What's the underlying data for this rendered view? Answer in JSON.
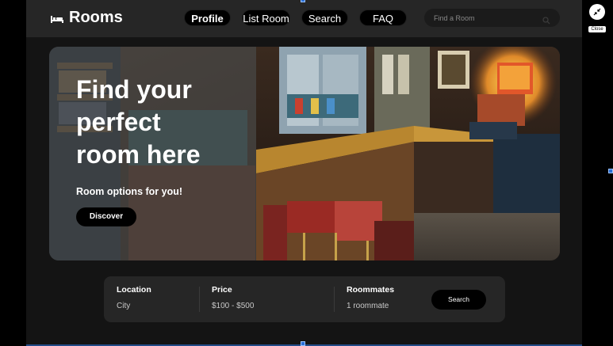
{
  "brand": {
    "name": "Rooms",
    "icon": "bed-icon"
  },
  "nav": {
    "links": [
      {
        "label": "Profile",
        "active": true
      },
      {
        "label": "List Room",
        "active": false
      },
      {
        "label": "Search",
        "active": false
      },
      {
        "label": "FAQ",
        "active": false
      }
    ],
    "search_placeholder": "Find a Room"
  },
  "hero": {
    "title": "Find your\nperfect\nroom here",
    "subtitle": "Room options for you!",
    "cta_label": "Discover"
  },
  "filters": {
    "location": {
      "label": "Location",
      "value": "City"
    },
    "price": {
      "label": "Price",
      "value": "$100 - $500"
    },
    "roommates": {
      "label": "Roommates",
      "value": "1 roommate"
    },
    "search_label": "Search"
  },
  "overlay": {
    "close_label": "Close",
    "icon": "collapse-icon"
  },
  "colors": {
    "background": "#141414",
    "navbar": "#262626",
    "pill": "#000000",
    "accent": "#2a6fd6"
  }
}
